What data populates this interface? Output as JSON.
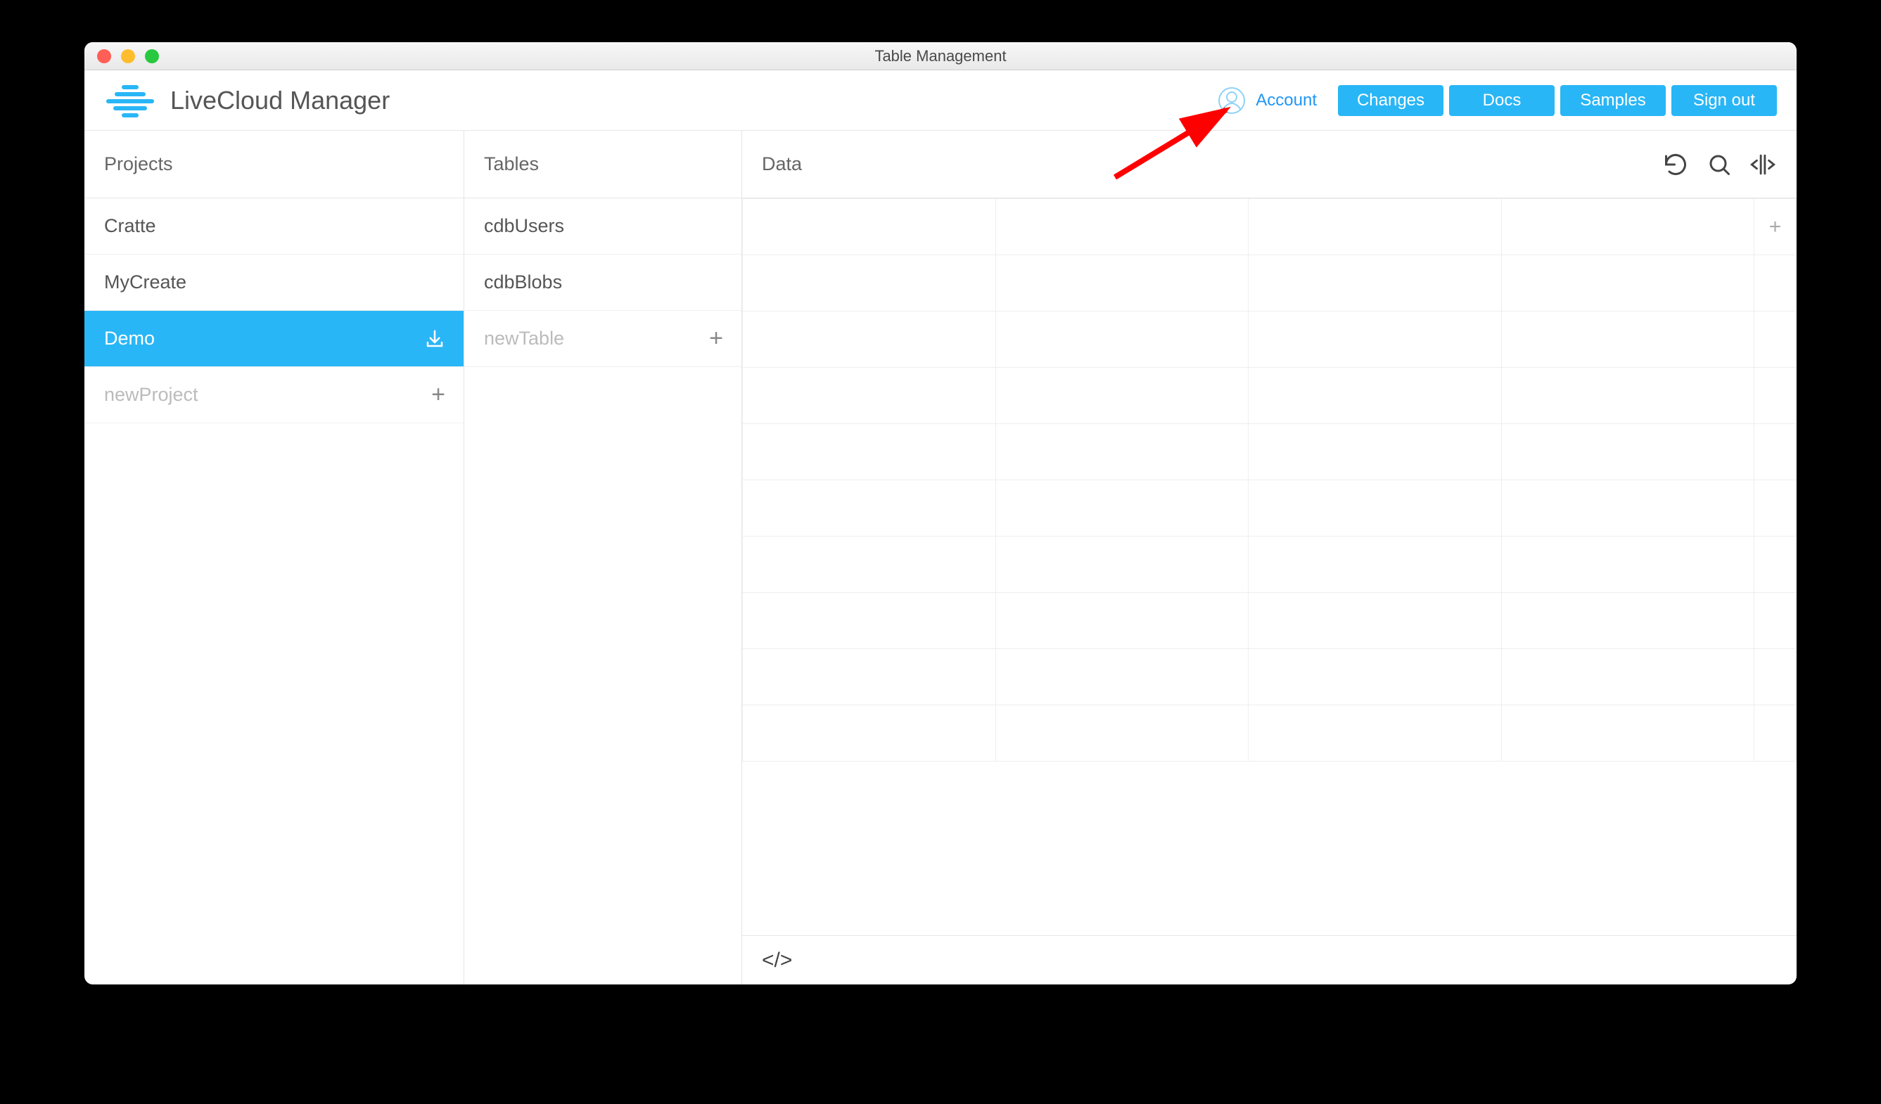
{
  "window": {
    "title": "Table Management"
  },
  "header": {
    "app_name": "LiveCloud Manager",
    "account_link": "Account",
    "buttons": {
      "changes": "Changes",
      "docs": "Docs",
      "samples": "Samples",
      "signout": "Sign out"
    }
  },
  "sidebar": {
    "projects_header": "Projects",
    "tables_header": "Tables",
    "data_header": "Data",
    "projects": [
      {
        "name": "Cratte",
        "selected": false
      },
      {
        "name": "MyCreate",
        "selected": false
      },
      {
        "name": "Demo",
        "selected": true
      }
    ],
    "new_project_placeholder": "newProject",
    "tables": [
      {
        "name": "cdbUsers"
      },
      {
        "name": "cdbBlobs"
      }
    ],
    "new_table_placeholder": "newTable"
  },
  "data_grid": {
    "columns": 4,
    "rows": 10,
    "add_column_symbol": "+"
  },
  "annotation": {
    "type": "arrow",
    "color": "#ff0000",
    "target": "account-icon"
  }
}
